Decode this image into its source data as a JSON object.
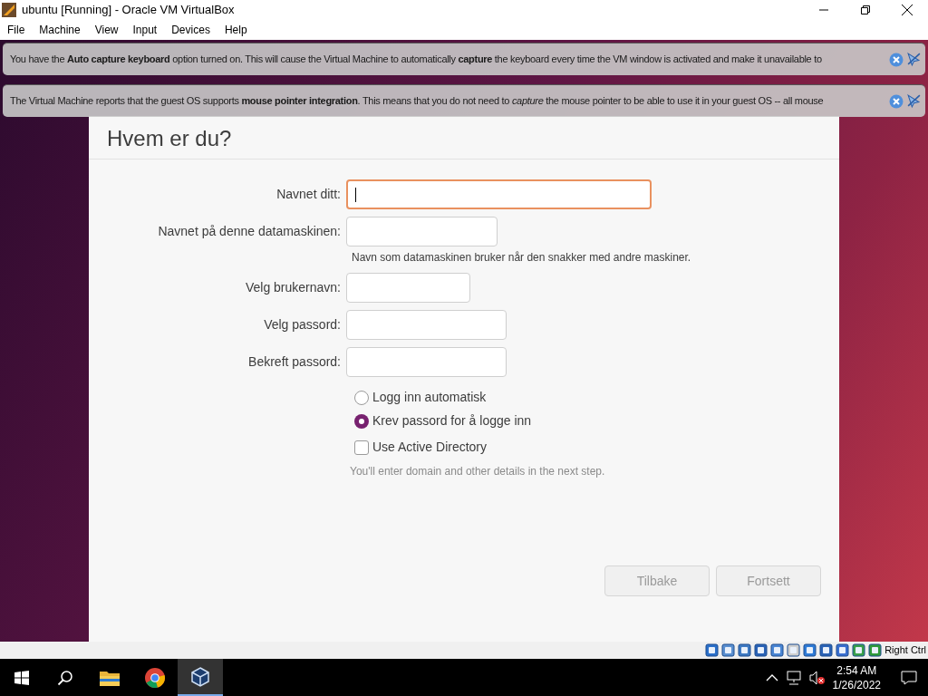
{
  "window": {
    "title": "ubuntu [Running] - Oracle VM VirtualBox"
  },
  "menu": [
    "File",
    "Machine",
    "View",
    "Input",
    "Devices",
    "Help"
  ],
  "notices": [
    {
      "text": "You have the **Auto capture keyboard** option turned on. This will cause the Virtual Machine to automatically **capture** the keyboard every time the VM window is activated and make it unavailable to"
    },
    {
      "text": "The Virtual Machine reports that the guest OS supports **mouse pointer integration**. This means that you do not need to *capture* the mouse pointer to be able to use it in your guest OS -- all mouse"
    }
  ],
  "dialog": {
    "heading": "Hvem er du?",
    "fields": [
      {
        "label": "Navnet ditt:",
        "focused": true
      },
      {
        "label": "Navnet på denne datamaskinen:",
        "focused": false,
        "hint": "Navn som datamaskinen bruker når den snakker med andre maskiner."
      },
      {
        "label": "Velg brukernavn:",
        "focused": false
      },
      {
        "label": "Velg passord:",
        "focused": false
      },
      {
        "label": "Bekreft passord:",
        "focused": false
      }
    ],
    "options": [
      {
        "kind": "radio",
        "label": "Logg inn automatisk",
        "selected": false
      },
      {
        "kind": "radio",
        "label": "Krev passord for å logge inn",
        "selected": true
      },
      {
        "kind": "checkbox",
        "label": "Use Active Directory",
        "checked": false
      }
    ],
    "note": "You'll enter domain and other details in the next step.",
    "buttons": [
      {
        "label": "Tilbake",
        "disabled": true
      },
      {
        "label": "Fortsett",
        "disabled": true
      }
    ]
  },
  "status_bar": {
    "host_key": "Right Ctrl"
  },
  "taskbar": {
    "time": "2:54 AM",
    "date": "1/26/2022"
  }
}
